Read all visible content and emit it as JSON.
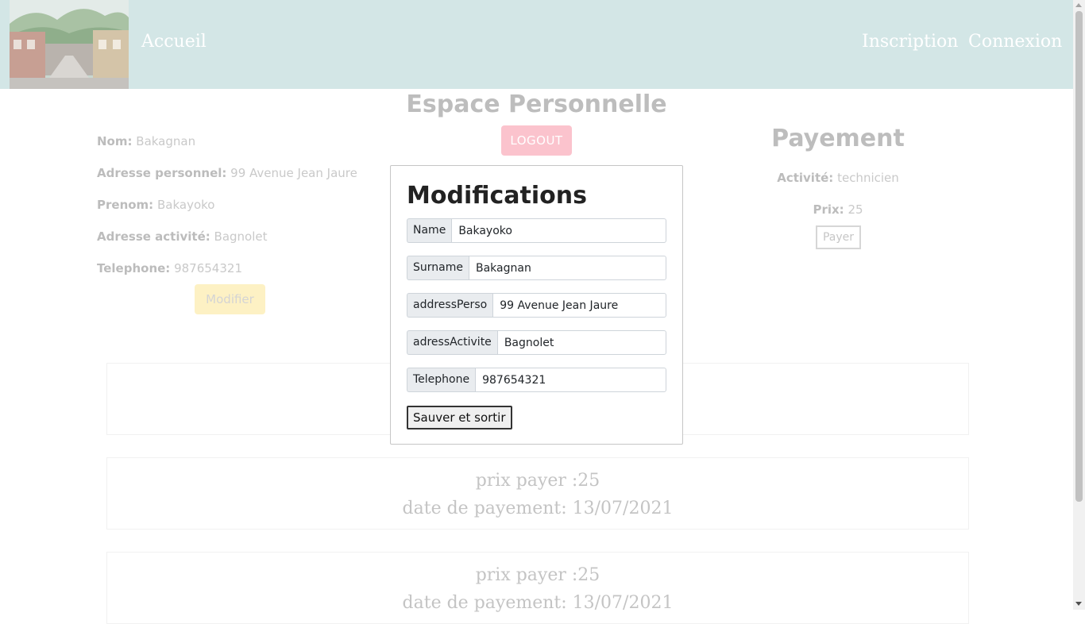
{
  "nav": {
    "home": "Accueil",
    "register": "Inscription",
    "login": "Connexion"
  },
  "page": {
    "title": "Espace Personnelle",
    "logout_label": "LOGOUT",
    "modify_label": "Modifier"
  },
  "profile": [
    {
      "label": "Nom:",
      "value": "Bakagnan"
    },
    {
      "label": "Adresse personnel:",
      "value": "99 Avenue Jean Jaure"
    },
    {
      "label": "Prenom:",
      "value": "Bakayoko"
    },
    {
      "label": "Adresse activité:",
      "value": "Bagnolet"
    },
    {
      "label": "Telephone:",
      "value": "987654321"
    }
  ],
  "payment": {
    "title": "Payement",
    "activity_label": "Activité:",
    "activity_value": "technicien",
    "price_label": "Prix:",
    "price_value": "25",
    "pay_label": "Payer"
  },
  "payments_history": [
    {
      "price": "prix payer :25",
      "date": "date de payement: 13/07/2021"
    },
    {
      "price": "prix payer :25",
      "date": "date de payement: 13/07/2021"
    }
  ],
  "modal": {
    "title": "Modifications",
    "fields": [
      {
        "label": "Name",
        "value": "Bakayoko"
      },
      {
        "label": "Surname",
        "value": "Bakagnan"
      },
      {
        "label": "addressPerso",
        "value": "99 Avenue Jean Jaure"
      },
      {
        "label": "adressActivite",
        "value": "Bagnolet"
      },
      {
        "label": "Telephone",
        "value": "987654321"
      }
    ],
    "save_label": "Sauver et sortir"
  },
  "colors": {
    "navbar": "#d3e6e6",
    "logout": "#fbc3cd",
    "modify": "#fdf1c4"
  }
}
